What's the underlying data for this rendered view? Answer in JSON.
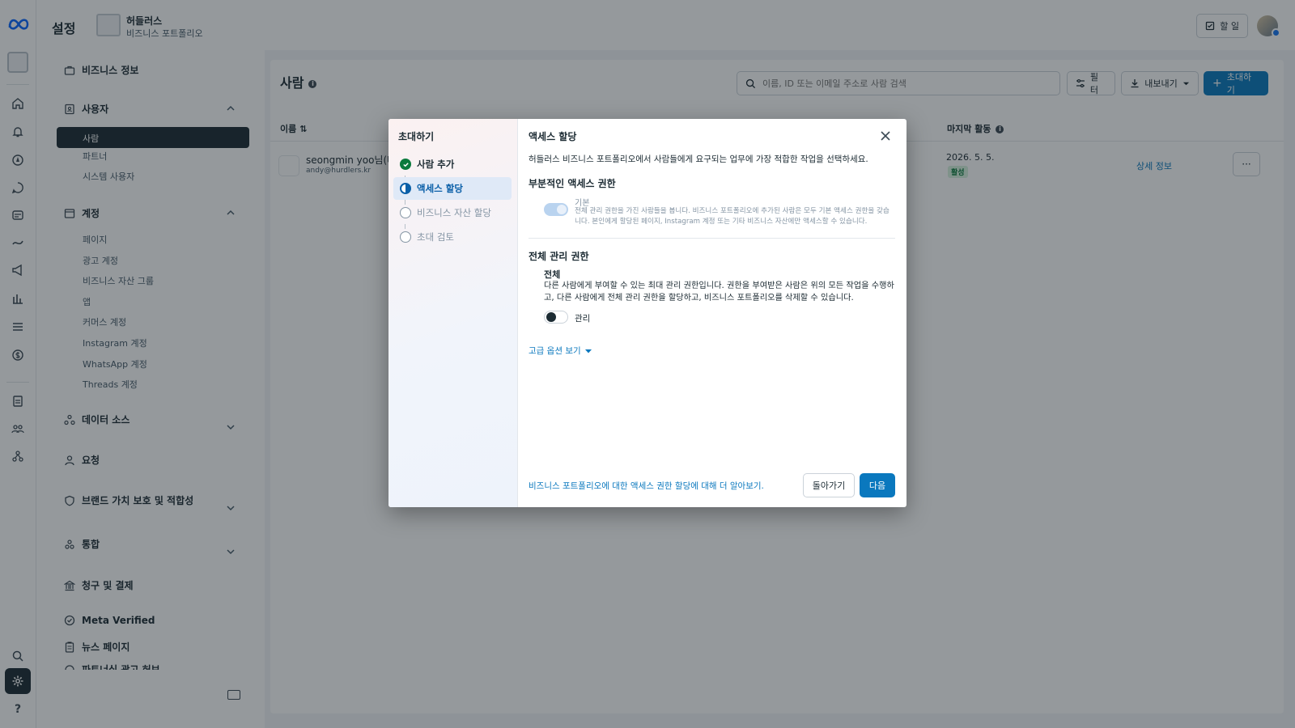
{
  "topbar": {
    "title": "설정",
    "business_name": "허들러스",
    "business_subtitle": "비즈니스 포트폴리오",
    "todo_label": "할 일"
  },
  "sidebar": {
    "sections": [
      {
        "label": "비즈니스 정보",
        "icon": "briefcase-icon"
      },
      {
        "label": "사용자",
        "icon": "user-badge-icon",
        "items": [
          "사람",
          "파트너",
          "시스템 사용자"
        ]
      },
      {
        "label": "계정",
        "icon": "folder-icon",
        "items": [
          "페이지",
          "광고 계정",
          "비즈니스 자산 그룹",
          "앱",
          "커머스 계정",
          "Instagram 계정",
          "WhatsApp 계정",
          "Threads 계정"
        ]
      },
      {
        "label": "데이터 소스",
        "icon": "data-source-icon"
      },
      {
        "label": "요청",
        "icon": "person-request-icon"
      },
      {
        "label": "브랜드 가치 보호 및 적합성",
        "icon": "shield-icon"
      },
      {
        "label": "통합",
        "icon": "integration-icon"
      },
      {
        "label": "청구 및 결제",
        "icon": "bank-icon"
      },
      {
        "label": "Meta Verified",
        "icon": "verified-icon"
      },
      {
        "label": "뉴스 페이지",
        "icon": "clipboard-icon"
      },
      {
        "label": "파트너십 광고 허브",
        "icon": "partnership-icon"
      }
    ]
  },
  "content": {
    "title": "사람",
    "search_placeholder": "이름, ID 또는 이메일 주소로 사람 검색",
    "filter_label": "필터",
    "export_label": "내보내기",
    "invite_label": "초대하기",
    "col_name": "이름",
    "col_last_activity": "마지막 활동",
    "row": {
      "name": "seongmin yoo님(나",
      "email": "andy@hurdlers.kr",
      "date": "2026. 5. 5.",
      "status": "활성",
      "detail_link": "상세 정보"
    }
  },
  "modal": {
    "steps_title": "초대하기",
    "steps": [
      {
        "label": "사람 추가",
        "state": "done"
      },
      {
        "label": "액세스 할당",
        "state": "current"
      },
      {
        "label": "비즈니스 자산 할당",
        "state": "pending"
      },
      {
        "label": "초대 검토",
        "state": "pending"
      }
    ],
    "title": "액세스 할당",
    "description": "허들러스 비즈니스 포트폴리오에서 사람들에게 요구되는 업무에 가장 적합한 작업을 선택하세요.",
    "partial_heading": "부분적인 액세스 권한",
    "basic_label": "기본",
    "basic_desc": "전체 관리 권한을 가진 사람들을 봅니다. 비즈니스 포트폴리오에 추가된 사람은 모두 기본 액세스 권한을 갖습니다. 본인에게 할당된 페이지, Instagram 계정 또는 기타 비즈니스 자산에만 액세스할 수 있습니다.",
    "full_heading": "전체 관리 권한",
    "full_label": "전체",
    "full_desc": "다른 사람에게 부여할 수 있는 최대 관리 권한입니다. 권한을 부여받은 사람은 위의 모든 작업을 수행하고, 다른 사람에게 전체 관리 권한을 할당하고, 비즈니스 포트폴리오를 삭제할 수 있습니다.",
    "admin_label": "관리",
    "admin_toggle_on": false,
    "basic_toggle_on": true,
    "advanced_link": "고급 옵션 보기",
    "learn_link": "비즈니스 포트폴리오에 대한 액세스 권한 할당에 대해 더 알아보기.",
    "back_label": "돌아가기",
    "next_label": "다음"
  },
  "colors": {
    "primary": "#0a78be",
    "dark": "#1c2b33",
    "success": "#0a7a3c"
  }
}
